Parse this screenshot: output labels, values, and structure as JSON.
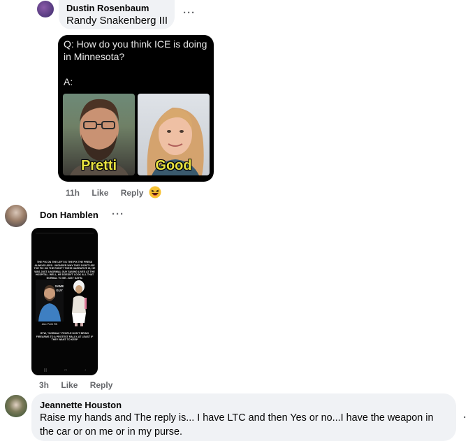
{
  "comment1": {
    "author": "Dustin Rosenbaum",
    "text": "Randy Snakenberg III",
    "more_label": "···"
  },
  "meme": {
    "question": "Q: How do you think ICE is doing in Minnesota?",
    "answer_label": "A:",
    "left_caption": "Pretti",
    "right_caption": "Good"
  },
  "meme_actions": {
    "time": "11h",
    "like": "Like",
    "reply": "Reply",
    "reaction": "haha-emoji"
  },
  "comment2": {
    "author": "Don Hamblen",
    "more_label": "···",
    "image": {
      "top_text": "THE PIX ON THE LEFT IS THE PIX THE PRESS ALWAYS USES. I WONDER WHY THEY DON'T USE THE PIX ON THE RIGHT? THEIR NARRATIVE IS, HE WAS JUST A NORMAL GUY SAVING LIVES AT THE HOSPITAL. WELL, HE DOESN'T LOOK ALL THAT NORMAL TO ME. JUST SAYIN.",
      "same_guy": "SAME GUY",
      "left_photo_label": "Alex Pretti RN",
      "bottom_text": "BTW, \"NORMAL\" PEOPLE DON'T BRING FIREARMS TO A PROTEST RALLY, AT LEAST IF THEY WANT TO KEEP"
    },
    "time": "3h",
    "like": "Like",
    "reply": "Reply"
  },
  "comment3": {
    "author": "Jeannette Houston",
    "text": "Raise my hands and The reply is... I have LTC and then Yes or no...I have the weapon in the car or on me or in my purse.",
    "more_label": "·"
  },
  "colors": {
    "bubble": "#f0f2f5",
    "meta": "#65676b",
    "caption": "#e8e341"
  }
}
